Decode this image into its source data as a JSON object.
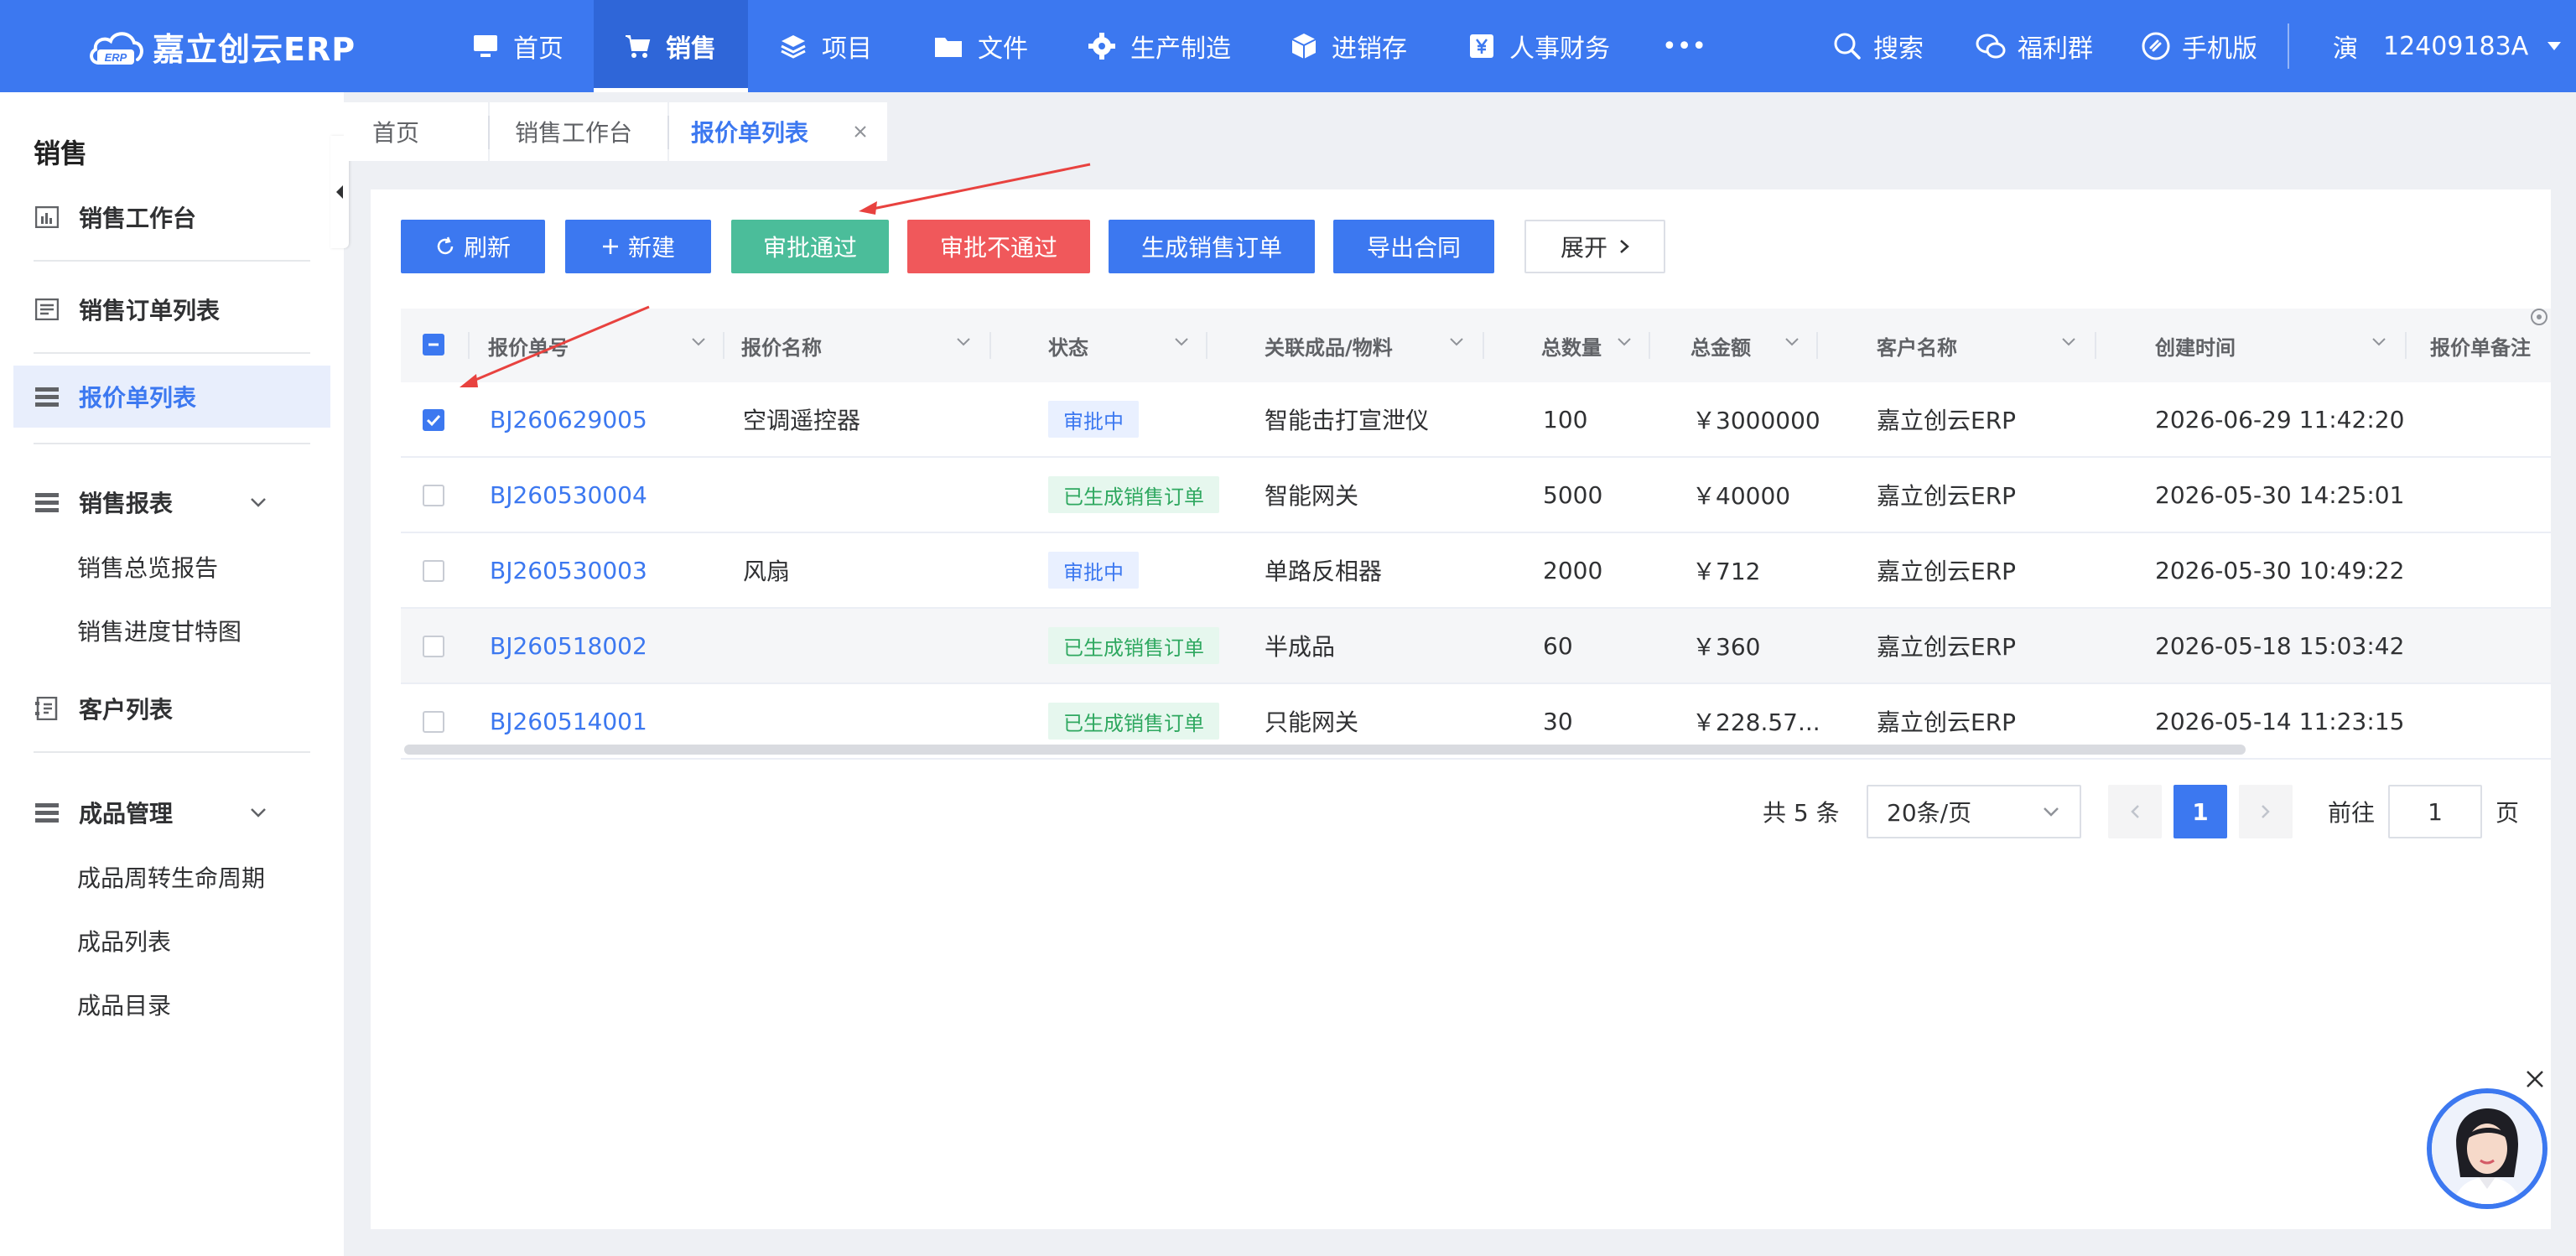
{
  "app": {
    "logo_text": "嘉立创云ERP",
    "logo_badge": "ERP"
  },
  "topnav": [
    {
      "label": "首页",
      "icon": "monitor-icon"
    },
    {
      "label": "销售",
      "icon": "cart-icon",
      "active": true
    },
    {
      "label": "项目",
      "icon": "layers-icon"
    },
    {
      "label": "文件",
      "icon": "folder-icon"
    },
    {
      "label": "生产制造",
      "icon": "gear-icon"
    },
    {
      "label": "进销存",
      "icon": "box-icon"
    },
    {
      "label": "人事财务",
      "icon": "yen-icon"
    },
    {
      "label": "•••",
      "icon": "more-icon"
    }
  ],
  "topright": {
    "search": "搜索",
    "welfare": "福利群",
    "mobile": "手机版",
    "user_avatar": "演",
    "username": "12409183A"
  },
  "sidebar": {
    "title": "销售",
    "items": [
      {
        "label": "销售工作台",
        "icon": "chart-icon"
      },
      {
        "label": "销售订单列表",
        "icon": "order-list-icon"
      },
      {
        "label": "报价单列表",
        "icon": "list-icon",
        "active": true
      },
      {
        "label": "销售报表",
        "icon": "list-icon",
        "expandable": true,
        "children": [
          "销售总览报告",
          "销售进度甘特图"
        ]
      },
      {
        "label": "客户列表",
        "icon": "customer-icon"
      },
      {
        "label": "成品管理",
        "icon": "list-icon",
        "expandable": true,
        "children": [
          "成品周转生命周期",
          "成品列表",
          "成品目录"
        ]
      }
    ]
  },
  "tabs": [
    {
      "label": "首页"
    },
    {
      "label": "销售工作台"
    },
    {
      "label": "报价单列表",
      "active": true,
      "closable": true
    }
  ],
  "toolbar": {
    "refresh": "刷新",
    "new": "新建",
    "approve": "审批通过",
    "reject": "审批不通过",
    "generate_order": "生成销售订单",
    "export_contract": "导出合同",
    "expand": "展开"
  },
  "table": {
    "columns": [
      "报价单号",
      "报价名称",
      "状态",
      "关联成品/物料",
      "总数量",
      "总金额",
      "客户名称",
      "创建时间",
      "报价单备注"
    ],
    "rows": [
      {
        "no": "BJ260629005",
        "name": "空调遥控器",
        "status": "审批中",
        "status_type": "pending",
        "product": "智能击打宣泄仪",
        "qty": "100",
        "amount": "￥3000000",
        "customer": "嘉立创云ERP",
        "created": "2026-06-29 11:42:20",
        "remark": "",
        "checked": true
      },
      {
        "no": "BJ260530004",
        "name": "",
        "status": "已生成销售订单",
        "status_type": "done",
        "product": "智能网关",
        "qty": "5000",
        "amount": "￥40000",
        "customer": "嘉立创云ERP",
        "created": "2026-05-30 14:25:01",
        "remark": "",
        "checked": false
      },
      {
        "no": "BJ260530003",
        "name": "风扇",
        "status": "审批中",
        "status_type": "pending",
        "product": "单路反相器",
        "qty": "2000",
        "amount": "￥712",
        "customer": "嘉立创云ERP",
        "created": "2026-05-30 10:49:22",
        "remark": "",
        "checked": false
      },
      {
        "no": "BJ260518002",
        "name": "",
        "status": "已生成销售订单",
        "status_type": "done",
        "product": "半成品",
        "qty": "60",
        "amount": "￥360",
        "customer": "嘉立创云ERP",
        "created": "2026-05-18 15:03:42",
        "remark": "",
        "checked": false
      },
      {
        "no": "BJ260514001",
        "name": "",
        "status": "已生成销售订单",
        "status_type": "done",
        "product": "只能网关",
        "qty": "30",
        "amount": "￥228.57...",
        "customer": "嘉立创云ERP",
        "created": "2026-05-14 11:23:15",
        "remark": "",
        "checked": false
      }
    ]
  },
  "pagination": {
    "total": "共 5 条",
    "page_size": "20条/页",
    "current": "1",
    "goto_label": "前往",
    "goto_value": "1",
    "page_suffix": "页"
  },
  "colors": {
    "primary": "#3c78f0",
    "approve": "#4bbd9a",
    "reject": "#f0585b"
  }
}
